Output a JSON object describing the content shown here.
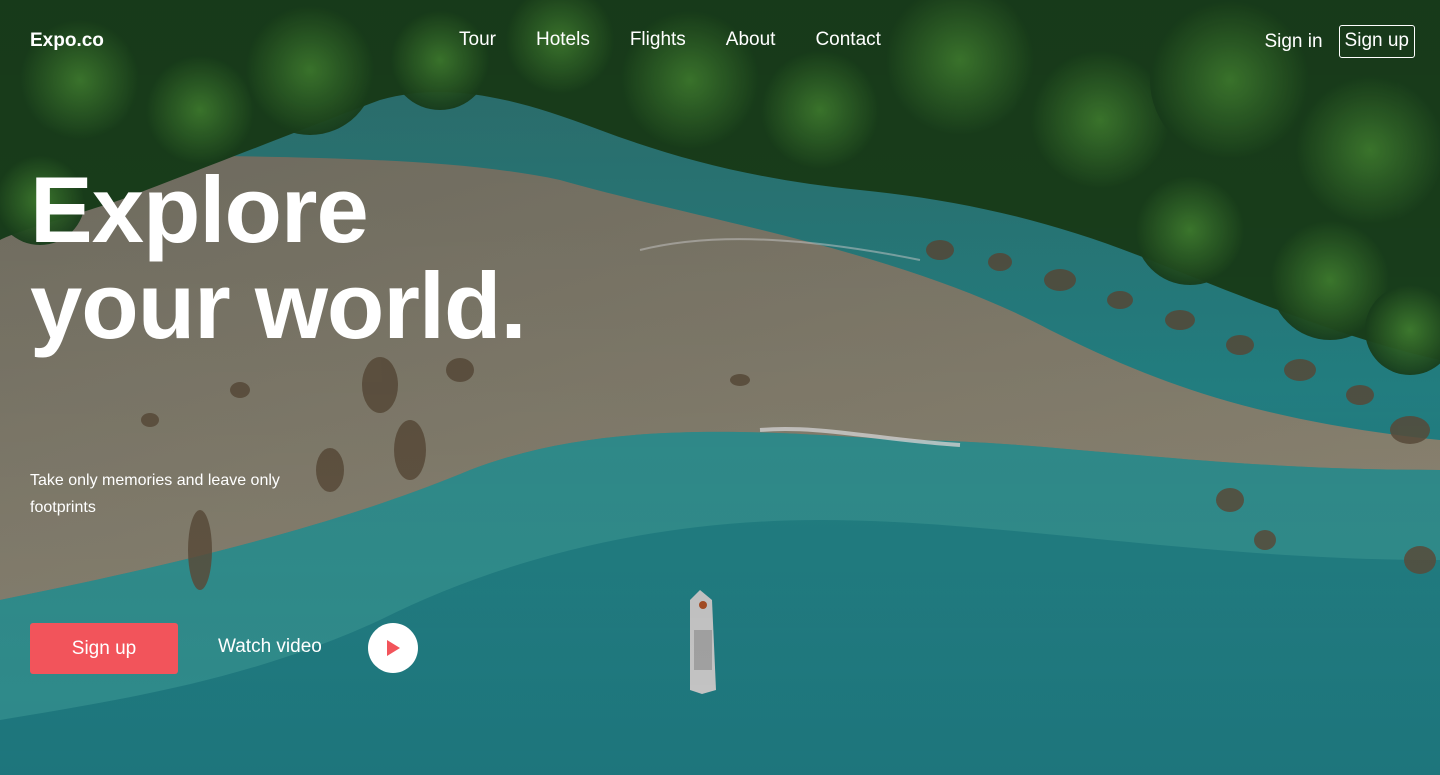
{
  "brand": {
    "name": "Expo.co"
  },
  "nav": {
    "items": [
      {
        "label": "Tour"
      },
      {
        "label": "Hotels"
      },
      {
        "label": "Flights"
      },
      {
        "label": "About"
      },
      {
        "label": "Contact"
      }
    ]
  },
  "auth": {
    "signin_label": "Sign in",
    "signup_label": "Sign up"
  },
  "hero": {
    "headline_line1": "Explore",
    "headline_line2": "your world.",
    "tagline": "Take only memories and leave only footprints",
    "cta_label": "Sign up",
    "watch_label": "Watch video",
    "play_icon": "play-icon"
  },
  "colors": {
    "accent": "#f2545b",
    "text": "#ffffff",
    "forest": "#1f5a2a",
    "sand": "#b9ad93",
    "water": "#2aa3a6"
  }
}
